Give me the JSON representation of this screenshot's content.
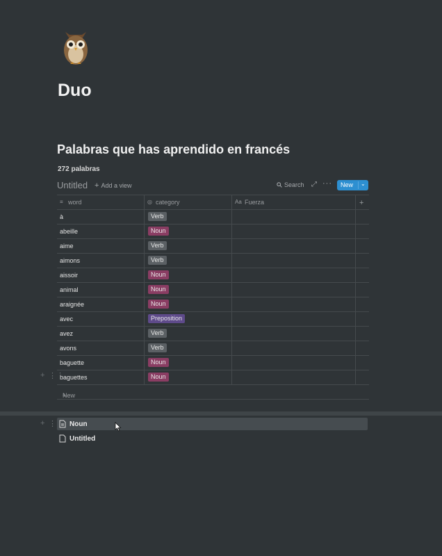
{
  "page": {
    "icon": "owl-icon",
    "title": "Duo",
    "heading": "Palabras que has aprendido en francés",
    "word_count": "272 palabras"
  },
  "database": {
    "view_name": "Untitled",
    "add_view_label": "Add a view",
    "search_label": "Search",
    "new_button_label": "New",
    "columns": [
      {
        "name": "word",
        "icon": "text-icon"
      },
      {
        "name": "category",
        "icon": "select-icon"
      },
      {
        "name": "Fuerza",
        "icon": "aa-text-icon"
      }
    ],
    "rows": [
      {
        "word": "à",
        "category": "Verb"
      },
      {
        "word": "abeille",
        "category": "Noun"
      },
      {
        "word": "aime",
        "category": "Verb"
      },
      {
        "word": "aimons",
        "category": "Verb"
      },
      {
        "word": "aissoir",
        "category": "Noun"
      },
      {
        "word": "animal",
        "category": "Noun"
      },
      {
        "word": "araignée",
        "category": "Noun"
      },
      {
        "word": "avec",
        "category": "Preposition"
      },
      {
        "word": "avez",
        "category": "Verb"
      },
      {
        "word": "avons",
        "category": "Verb"
      },
      {
        "word": "baguette",
        "category": "Noun"
      },
      {
        "word": "baguettes",
        "category": "Noun"
      }
    ],
    "new_row_label": "New"
  },
  "category_colors": {
    "Verb": "#5b6064",
    "Noun": "#8a3d63",
    "Preposition": "#5e4a8a"
  },
  "subpages": [
    {
      "label": "Noun",
      "icon": "page-icon",
      "highlighted": true
    },
    {
      "label": "Untitled",
      "icon": "page-icon",
      "highlighted": false
    }
  ]
}
